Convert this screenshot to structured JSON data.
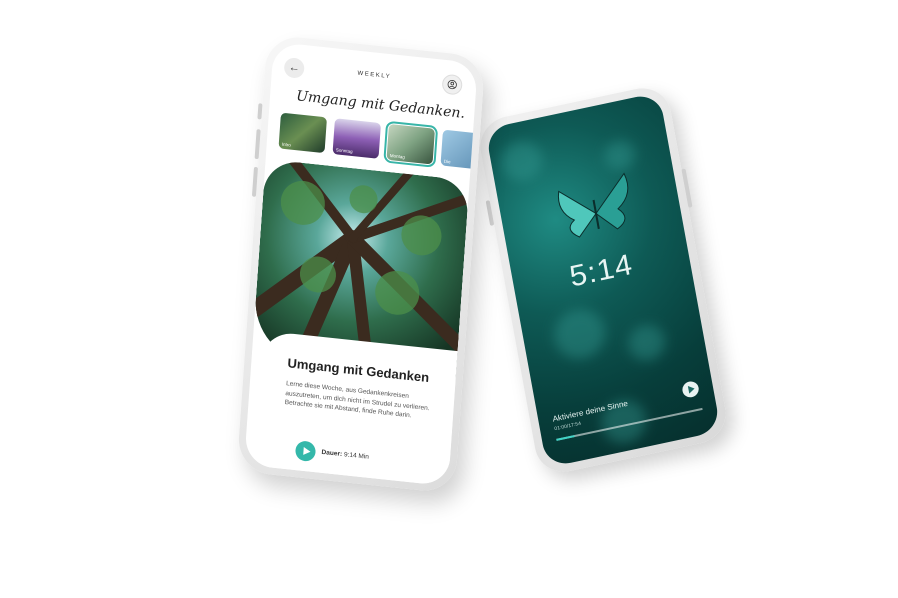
{
  "phone_left": {
    "header": {
      "back_icon": "arrow-left-icon",
      "label": "WEEKLY",
      "profile_icon": "user-circle-icon"
    },
    "script_title": "Umgang mit Gedanken.",
    "thumbnails": [
      {
        "label": "Intro",
        "selected": false
      },
      {
        "label": "Sonntag",
        "selected": false
      },
      {
        "label": "Montag",
        "selected": true
      },
      {
        "label": "Die",
        "selected": false
      }
    ],
    "card": {
      "title": "Umgang mit Gedanken",
      "description": "Lerne diese Woche, aus Gedankenkreisen auszutreten, um dich nicht im Strudel zu verlieren. Betrachte sie mit Abstand, finde Ruhe darin.",
      "duration_label": "Dauer:",
      "duration_value": "9:14 Min"
    }
  },
  "phone_right": {
    "clock": "5:14",
    "track_title": "Aktiviere deine Sinne",
    "track_time": "01:00/17:54",
    "progress": 0.12
  },
  "colors": {
    "accent": "#34b8aa",
    "dark_teal": "#0e5a55"
  }
}
